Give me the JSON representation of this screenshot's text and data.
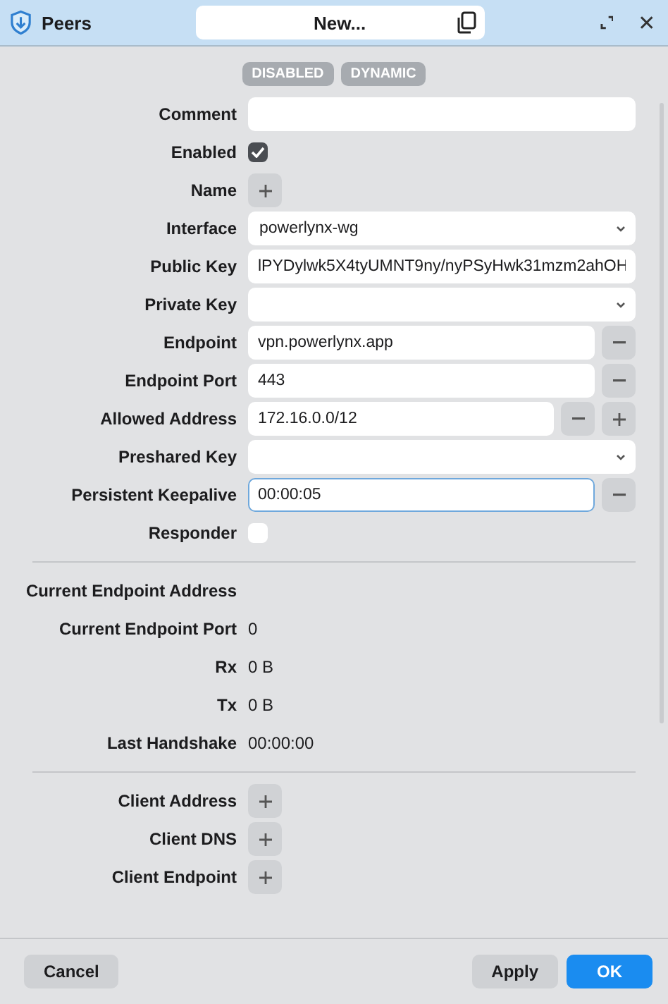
{
  "window": {
    "title": "Peers",
    "document_title": "New..."
  },
  "badges": [
    "DISABLED",
    "DYNAMIC"
  ],
  "form": [
    {
      "label": "Comment",
      "kind": "text",
      "focused": false,
      "remove": false,
      "add": false
    },
    {
      "label": "Enabled",
      "kind": "checkbox",
      "checked": true
    },
    {
      "label": "Name",
      "kind": "add"
    },
    {
      "label": "Interface",
      "kind": "select",
      "value": "powerlynx-wg"
    },
    {
      "label": "Public Key",
      "kind": "text",
      "value": "lPYDylwk5X4tyUMNT9ny/nyPSyHwk31mzm2ahOH",
      "focused": false,
      "remove": false,
      "add": false
    },
    {
      "label": "Private Key",
      "kind": "select"
    },
    {
      "label": "Endpoint",
      "kind": "text",
      "value": "vpn.powerlynx.app",
      "focused": false,
      "remove": true,
      "add": false
    },
    {
      "label": "Endpoint Port",
      "kind": "text",
      "value": "443",
      "focused": false,
      "remove": true,
      "add": false
    },
    {
      "label": "Allowed Address",
      "kind": "text",
      "value": "172.16.0.0/12",
      "focused": false,
      "remove": true,
      "add": true
    },
    {
      "label": "Preshared Key",
      "kind": "select"
    },
    {
      "label": "Persistent Keepalive",
      "kind": "text",
      "value": "00:00:05",
      "focused": true,
      "remove": true,
      "add": false
    },
    {
      "label": "Responder",
      "kind": "checkbox",
      "checked": false
    }
  ],
  "status": [
    {
      "label": "Current Endpoint Address"
    },
    {
      "label": "Current Endpoint Port",
      "value": "0"
    },
    {
      "label": "Rx",
      "value": "0 B"
    },
    {
      "label": "Tx",
      "value": "0 B"
    },
    {
      "label": "Last Handshake",
      "value": "00:00:00"
    }
  ],
  "client": [
    {
      "label": "Client Address"
    },
    {
      "label": "Client DNS"
    },
    {
      "label": "Client Endpoint"
    }
  ],
  "footer": {
    "cancel": "Cancel",
    "apply": "Apply",
    "ok": "OK"
  }
}
